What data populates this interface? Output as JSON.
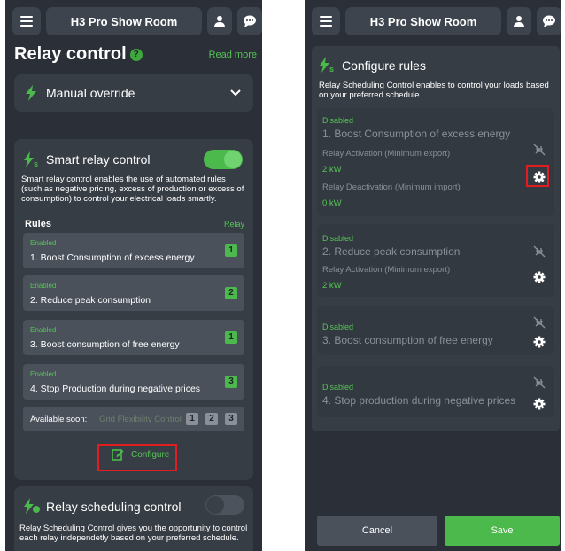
{
  "left": {
    "header": {
      "title": "H3 Pro Show Room"
    },
    "page_title": "Relay control",
    "read_more": "Read more",
    "manual_override": {
      "label": "Manual override"
    },
    "smart": {
      "title": "Smart relay control",
      "toggle_on": true,
      "description": "Smart relay control enables the use of automated rules (such as negative pricing, excess of production or excess of consumption) to control your electrical loads smartly.",
      "rules_header": "Rules",
      "relay_header": "Relay",
      "rules": [
        {
          "status": "Enabled",
          "name": "1. Boost Consumption of excess energy",
          "relay": "1"
        },
        {
          "status": "Enabled",
          "name": "2. Reduce peak consumption",
          "relay": "2"
        },
        {
          "status": "Enabled",
          "name": "3. Boost consumption of free energy",
          "relay": "1"
        },
        {
          "status": "Enabled",
          "name": "4. Stop Production during negative prices",
          "relay": "3"
        }
      ],
      "available_soon_label": "Available soon:",
      "available_soon_feature": "Grid Flexibility Control",
      "available_soon_relays": [
        "1",
        "2",
        "3"
      ],
      "configure_label": "Configure"
    },
    "scheduling": {
      "title": "Relay scheduling control",
      "toggle_on": false,
      "description": "Relay Scheduling Control gives you the opportunity to control each relay independetly based on your preferred schedule."
    }
  },
  "right": {
    "header": {
      "title": "H3 Pro Show Room"
    },
    "title": "Configure rules",
    "description": "Relay Scheduling Control enables to control your loads based on your preferred schedule.",
    "rules": [
      {
        "status": "Disabled",
        "name": "1. Boost Consumption of excess energy",
        "activation_label": "Relay Activation (Minimum export)",
        "activation_value": "2 kW",
        "deactivation_label": "Relay Deactivation (Minimum import)",
        "deactivation_value": "0 kW"
      },
      {
        "status": "Disabled",
        "name": "2. Reduce peak consumption",
        "activation_label": "Relay Activation (Minimum export)",
        "activation_value": "2 kW"
      },
      {
        "status": "Disabled",
        "name": "3. Boost consumption of free energy"
      },
      {
        "status": "Disabled",
        "name": "4. Stop production during negative prices"
      }
    ],
    "cancel_label": "Cancel",
    "save_label": "Save"
  },
  "colors": {
    "accent": "#4cb94c",
    "background": "#2b3038",
    "card": "#373d45",
    "highlight": "#e01e22"
  },
  "icons": [
    "menu-icon",
    "user-icon",
    "chat-icon",
    "help-icon",
    "bolt-icon",
    "chevron-down-icon",
    "smart-bolt-icon",
    "edit-icon",
    "schedule-bolt-icon",
    "unplug-icon",
    "gear-icon"
  ]
}
